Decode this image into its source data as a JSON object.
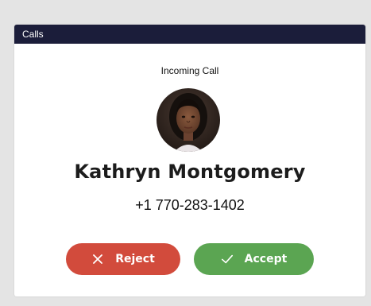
{
  "window": {
    "title": "Calls"
  },
  "call": {
    "status_label": "Incoming Call",
    "caller_name": "Kathryn Montgomery",
    "caller_phone": "+1 770-283-1402"
  },
  "actions": {
    "reject_label": "Reject",
    "reject_icon": "close-icon",
    "reject_color": "#d24b3c",
    "accept_label": "Accept",
    "accept_icon": "check-icon",
    "accept_color": "#5ba552"
  },
  "colors": {
    "titlebar": "#1b1d3a",
    "background": "#e4e4e4",
    "card": "#ffffff"
  }
}
